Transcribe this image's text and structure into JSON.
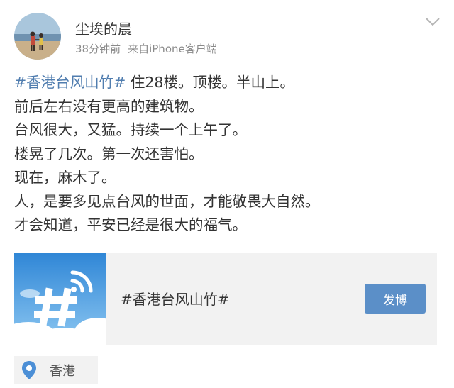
{
  "user": {
    "name": "尘埃的晨",
    "time": "38分钟前",
    "source": "来自iPhone客户端"
  },
  "post": {
    "hashtag": "#香港台风山竹#",
    "line1_rest": " 住28楼。顶楼。半山上。",
    "lines": [
      "前后左右没有更高的建筑物。",
      "台风很大，又猛。持续一个上午了。",
      "楼晃了几次。第一次还害怕。",
      "现在，麻木了。",
      "人，是要多见点台风的世面，才能敬畏大自然。",
      "才会知道，平安已经是很大的福气。"
    ]
  },
  "topic_card": {
    "title": "#香港台风山竹#",
    "button_label": "发博",
    "thumb_icon": "hashtag-icon"
  },
  "location": {
    "label": "香港",
    "icon": "location-pin-icon"
  },
  "colors": {
    "link": "#507daf",
    "button": "#5b8fc8",
    "card_bg": "#f2f2f2",
    "meta_text": "#8a8a8a"
  }
}
